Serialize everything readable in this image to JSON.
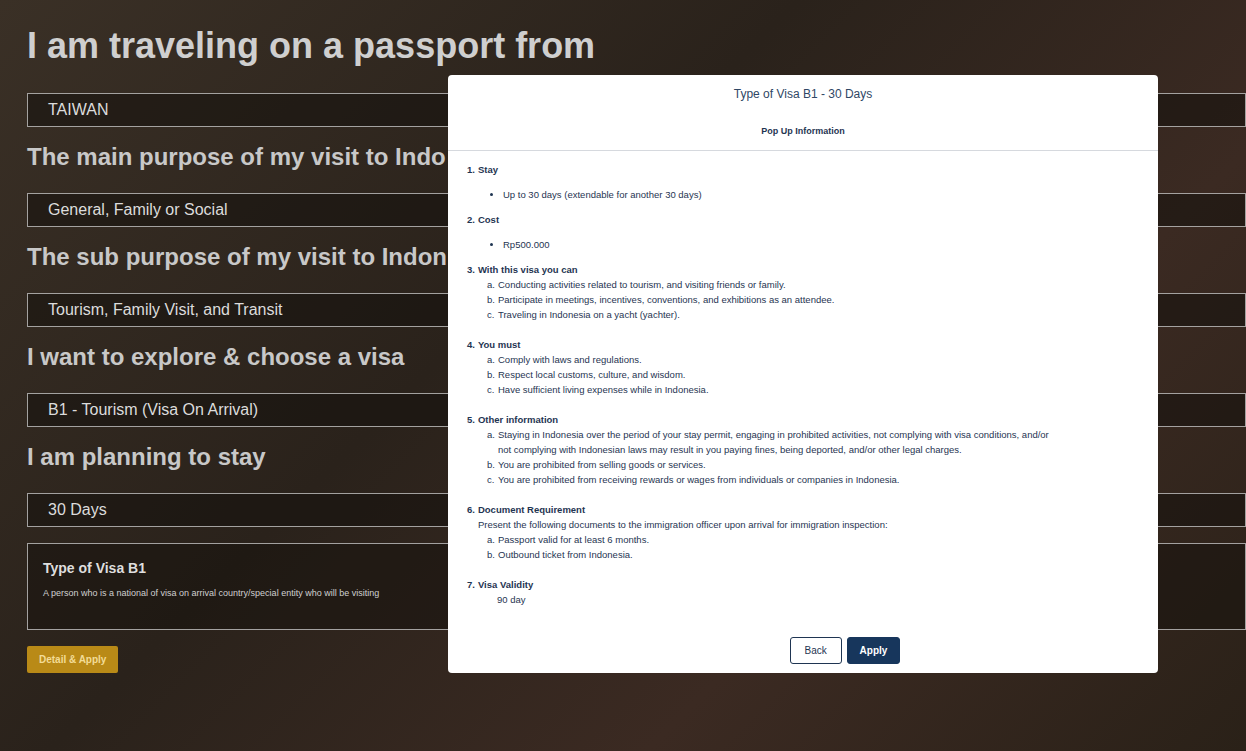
{
  "form": {
    "fields": [
      {
        "kind": "heading",
        "label": "I am traveling on a passport from",
        "value": "TAIWAN"
      },
      {
        "kind": "label",
        "label": "The main purpose of my visit to Indo",
        "value": "General, Family or Social"
      },
      {
        "kind": "label",
        "label": "The sub purpose of my visit to Indon",
        "value": "Tourism, Family Visit, and Transit"
      },
      {
        "kind": "label",
        "label": "I want to explore & choose a visa",
        "value": "B1 - Tourism (Visa On Arrival)"
      },
      {
        "kind": "label",
        "label": "I am planning to stay",
        "value": "30 Days"
      }
    ]
  },
  "visa_card": {
    "title": "Type of Visa B1",
    "description": "A person who is a national of visa on arrival country/special entity who will be visiting"
  },
  "detail_button": "Detail & Apply",
  "modal": {
    "title": "Type of Visa B1 - 30 Days",
    "subtitle": "Pop Up Information",
    "sections": [
      {
        "number": "1.",
        "heading": "Stay",
        "kind": "bullets",
        "intro": "",
        "items": [
          {
            "marker": "",
            "text": "Up to 30 days (extendable for another 30 days)"
          }
        ]
      },
      {
        "number": "2.",
        "heading": "Cost",
        "kind": "bullets",
        "intro": "",
        "items": [
          {
            "marker": "",
            "text": "Rp500.000"
          }
        ]
      },
      {
        "number": "3.",
        "heading": "With this visa you can",
        "kind": "letters",
        "intro": "",
        "items": [
          {
            "marker": "a.",
            "text": "Conducting activities related to tourism, and visiting friends or family."
          },
          {
            "marker": "b.",
            "text": "Participate in meetings, incentives, conventions, and exhibitions as an attendee."
          },
          {
            "marker": "c.",
            "text": "Traveling in Indonesia on a yacht (yachter)."
          }
        ]
      },
      {
        "number": "4.",
        "heading": "You must",
        "kind": "letters",
        "intro": "",
        "items": [
          {
            "marker": "a.",
            "text": "Comply with laws and regulations."
          },
          {
            "marker": "b.",
            "text": "Respect local customs, culture, and wisdom."
          },
          {
            "marker": "c.",
            "text": "Have sufficient living expenses while in Indonesia."
          }
        ]
      },
      {
        "number": "5.",
        "heading": "Other information",
        "kind": "letters",
        "intro": "",
        "items": [
          {
            "marker": "a.",
            "text": "Staying in Indonesia over the period of your stay permit, engaging in prohibited activities, not complying with visa conditions, and/or not complying with Indonesian laws may result in you paying fines, being deported, and/or other legal charges."
          },
          {
            "marker": "b.",
            "text": "You are prohibited from selling goods or services."
          },
          {
            "marker": "c.",
            "text": "You are prohibited from receiving rewards or wages from individuals or companies in Indonesia."
          }
        ]
      },
      {
        "number": "6.",
        "heading": "Document Requirement",
        "kind": "letters",
        "intro": "Present the following documents to the immigration officer upon arrival for immigration inspection:",
        "items": [
          {
            "marker": "a.",
            "text": "Passport valid for at least 6 months."
          },
          {
            "marker": "b.",
            "text": "Outbound ticket from Indonesia."
          }
        ]
      },
      {
        "number": "7.",
        "heading": "Visa Validity",
        "kind": "plain",
        "intro": "",
        "items": [
          {
            "marker": "",
            "text": "90 day"
          }
        ]
      }
    ],
    "buttons": [
      {
        "label": "Back",
        "primary": false
      },
      {
        "label": "Apply",
        "primary": true
      }
    ]
  }
}
